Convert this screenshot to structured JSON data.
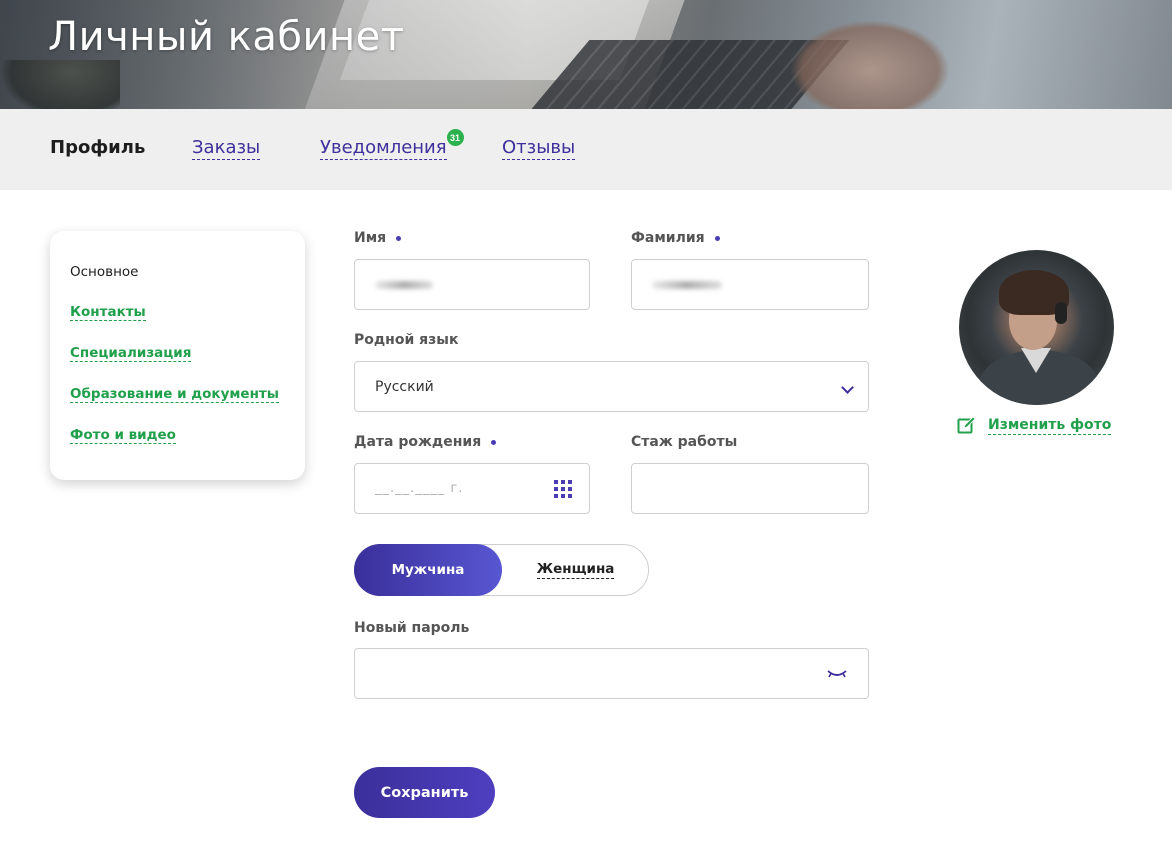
{
  "header": {
    "title": "Личный кабинет"
  },
  "tabs": [
    {
      "label": "Профиль",
      "active": true
    },
    {
      "label": "Заказы",
      "active": false
    },
    {
      "label": "Уведомления",
      "active": false,
      "badge": "31"
    },
    {
      "label": "Отзывы",
      "active": false
    }
  ],
  "sidebar": {
    "items": [
      {
        "label": "Основное",
        "current": true
      },
      {
        "label": "Контакты",
        "current": false
      },
      {
        "label": "Специализация",
        "current": false
      },
      {
        "label": "Образование и документы",
        "current": false
      },
      {
        "label": "Фото и видео",
        "current": false
      }
    ]
  },
  "form": {
    "first_name": {
      "label": "Имя",
      "required": true
    },
    "last_name": {
      "label": "Фамилия",
      "required": true
    },
    "native_language": {
      "label": "Родной язык",
      "value": "Русский"
    },
    "birth_date": {
      "label": "Дата рождения",
      "required": true,
      "placeholder": "__.__.____ г."
    },
    "experience": {
      "label": "Стаж работы",
      "value": ""
    },
    "gender": {
      "options": [
        "Мужчина",
        "Женщина"
      ],
      "selected": "Мужчина"
    },
    "new_password": {
      "label": "Новый пароль",
      "value": ""
    },
    "save_label": "Сохранить"
  },
  "profile_photo": {
    "change_label": "Изменить фото"
  },
  "colors": {
    "accent": "#3d2f9c",
    "link_green": "#20a04a",
    "badge_green": "#2bb24c",
    "tab_bar_bg": "#efefef"
  },
  "icons": {
    "select_arrow": "chevron-down-icon",
    "calendar": "calendar-icon",
    "password_toggle": "eye-closed-icon",
    "edit_photo": "edit-icon"
  }
}
